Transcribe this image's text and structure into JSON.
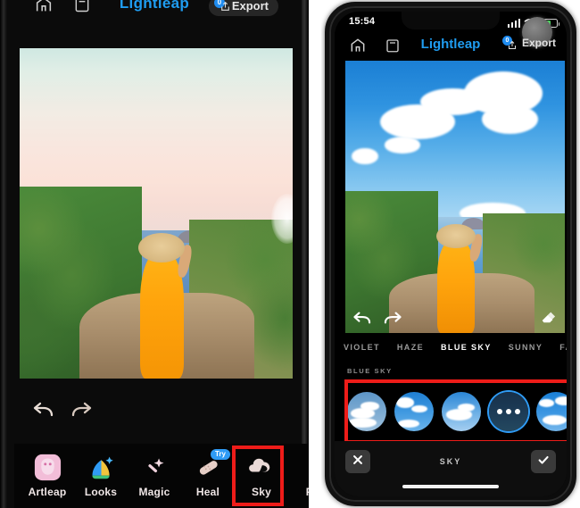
{
  "left_panel": {
    "header": {
      "home_icon": "home-icon",
      "layers_icon": "layers-icon",
      "app_title": "Lightleap",
      "export_label": "Export",
      "export_badge": "0"
    },
    "photo": {
      "description": "Woman in yellow dress with straw hat overlooking the ocean, original pastel sky"
    },
    "history": {
      "undo_icon": "undo-arrow-icon",
      "redo_icon": "redo-arrow-icon"
    },
    "tools": [
      {
        "label": "Artleap",
        "icon": "artleap-icon",
        "badge": "",
        "selected": false
      },
      {
        "label": "Looks",
        "icon": "looks-icon",
        "badge": "",
        "selected": false
      },
      {
        "label": "Magic",
        "icon": "magic-wand-icon",
        "badge": "",
        "selected": false
      },
      {
        "label": "Heal",
        "icon": "heal-bandage-icon",
        "badge": "Try",
        "selected": false
      },
      {
        "label": "Sky",
        "icon": "sky-cloud-icon",
        "badge": "",
        "selected": true
      },
      {
        "label": "Fil",
        "icon": "filters-icon",
        "badge": "",
        "selected": false
      }
    ]
  },
  "right_panel": {
    "status_bar": {
      "time": "15:54",
      "signal_icon": "cellular-signal-icon",
      "wifi_icon": "wifi-icon",
      "battery_icon": "battery-charging-icon"
    },
    "header": {
      "home_icon": "home-icon",
      "layers_icon": "layers-icon",
      "app_title": "Lightleap",
      "export_label": "Export",
      "export_badge": "0"
    },
    "photo": {
      "description": "Same scene with replaced vivid blue sky and white clouds"
    },
    "photo_tools": {
      "undo_icon": "undo-arrow-icon",
      "redo_icon": "redo-arrow-icon",
      "eraser_icon": "eraser-icon"
    },
    "tabs": [
      {
        "label": "VIOLET",
        "active": false
      },
      {
        "label": "HAZE",
        "active": false
      },
      {
        "label": "BLUE SKY",
        "active": true
      },
      {
        "label": "SUNNY",
        "active": false
      },
      {
        "label": "FANTA",
        "active": false
      }
    ],
    "section_label": "BLUE SKY",
    "next_section_label": "SUNNY",
    "thumbnails": [
      {
        "name": "blue-sky-1",
        "selected": false,
        "loading": false
      },
      {
        "name": "blue-sky-2",
        "selected": false,
        "loading": false
      },
      {
        "name": "blue-sky-3",
        "selected": false,
        "loading": false
      },
      {
        "name": "blue-sky-4",
        "selected": true,
        "loading": true
      },
      {
        "name": "blue-sky-5",
        "selected": false,
        "loading": false
      }
    ],
    "bottom_bar": {
      "cancel_icon": "close-x-icon",
      "title": "SKY",
      "confirm_icon": "check-icon"
    }
  },
  "colors": {
    "accent_blue": "#1f9cf0",
    "highlight_red": "#ee1c19",
    "selected_ring": "#2f9bf5",
    "dress_orange": "#ffa40c"
  }
}
